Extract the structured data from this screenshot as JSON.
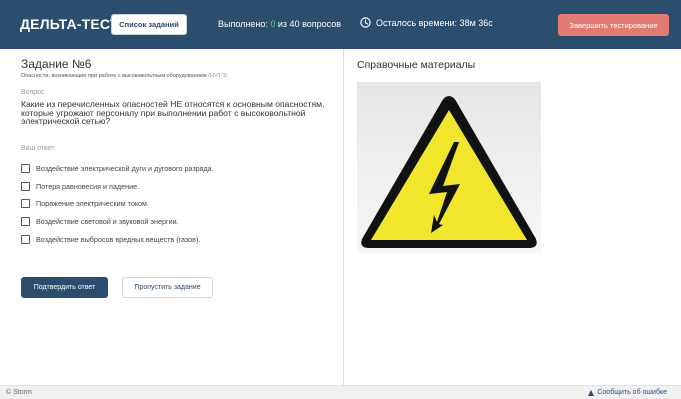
{
  "header": {
    "logo": "ДЕЛЬТА-ТЕСТ",
    "tasks_button": "Список заданий",
    "progress_prefix": "Выполнено:",
    "progress_done": "0",
    "progress_suffix": "из 40 вопросов",
    "timer_icon": "clock-icon",
    "timer_text": "Осталось времени: 38м 36с",
    "finish_button": "Завершить тестирование"
  },
  "task": {
    "title": "Задание №6",
    "subtitle": "Опасности, возникающие при работе с высоковольтным оборудованием",
    "subtitle_code": "(НVT/3)",
    "question_label": "Вопрос",
    "question": "Какие из перечисленных опасностей НЕ относятся к основным опасностям, которые угрожают персоналу при выполнении работ с высоковольтной электрической сетью?",
    "answer_label": "Ваш ответ",
    "options": [
      {
        "label": "Воздействие электрической дуги и дугового разряда.",
        "checked": false
      },
      {
        "label": "Потеря равновесия и падение.",
        "checked": false
      },
      {
        "label": "Поражение электрическим током.",
        "checked": false
      },
      {
        "label": "Воздействие световой и звуковой энергии.",
        "checked": false
      },
      {
        "label": "Воздействие выбросов вредных веществ (газов).",
        "checked": false
      }
    ],
    "confirm_button": "Подтвердить ответ",
    "skip_button": "Пропустить задание"
  },
  "reference": {
    "title": "Справочные материалы",
    "image_icon": "high-voltage-warning-icon"
  },
  "footer": {
    "copyright": "© Storm",
    "report_icon": "warning-triangle-icon",
    "report_link": "Сообщить об ошибке"
  },
  "colors": {
    "header_bg": "#2b4d6e",
    "accent_green": "#62d18a",
    "finish_button_bg": "#e07a72",
    "warning_yellow": "#f2e62c"
  }
}
